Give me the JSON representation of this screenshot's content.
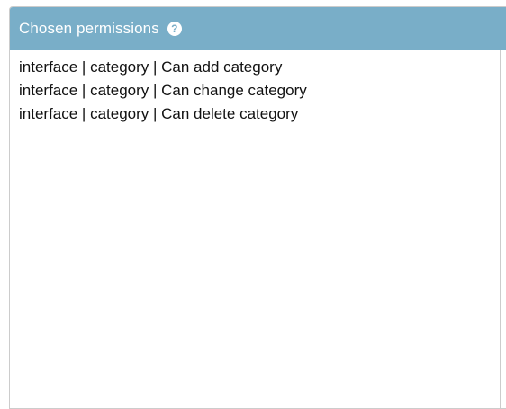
{
  "selector": {
    "title": "Chosen permissions",
    "help_icon": "question-circle-icon",
    "header_color": "#79aec8",
    "options": [
      "interface | category | Can add category",
      "interface | category | Can change category",
      "interface | category | Can delete category"
    ]
  }
}
